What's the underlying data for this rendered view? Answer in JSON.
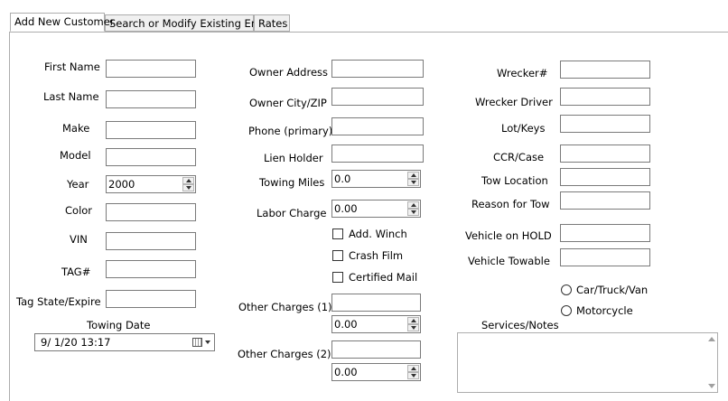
{
  "tabs": [
    {
      "label": "Add New Customer",
      "active": true
    },
    {
      "label": "Search or Modify Existing Entries",
      "active": false
    },
    {
      "label": "Rates",
      "active": false
    }
  ],
  "left": {
    "first_name": "First Name",
    "last_name": "Last Name",
    "make": "Make",
    "model": "Model",
    "year": "Year",
    "year_value": "2000",
    "color": "Color",
    "vin": "VIN",
    "tag": "TAG#",
    "tag_state": "Tag State/Expire",
    "towing_date": "Towing Date",
    "towing_date_value": "9/  1/20 13:17"
  },
  "middle": {
    "owner_address": "Owner Address",
    "owner_city_zip": "Owner City/ZIP",
    "phone": "Phone (primary)",
    "lien_holder": "Lien Holder",
    "towing_miles": "Towing Miles",
    "towing_miles_value": "0.0",
    "labor_charge": "Labor Charge",
    "labor_charge_value": "0.00",
    "add_winch": "Add. Winch",
    "crash_film": "Crash Film",
    "certified_mail": "Certified Mail",
    "other_charges_1": "Other Charges (1)",
    "other_charges_1_value": "0.00",
    "other_charges_2": "Other Charges (2)",
    "other_charges_2_value": "0.00"
  },
  "right": {
    "wrecker": "Wrecker#",
    "wrecker_driver": "Wrecker Driver",
    "lot_keys": "Lot/Keys",
    "ccr_case": "CCR/Case",
    "tow_location": "Tow Location",
    "reason_for_tow": "Reason for Tow",
    "vehicle_on_hold": "Vehicle on HOLD",
    "vehicle_towable": "Vehicle Towable",
    "car_truck_van": "Car/Truck/Van",
    "motorcycle": "Motorcycle",
    "services_notes": "Services/Notes"
  }
}
